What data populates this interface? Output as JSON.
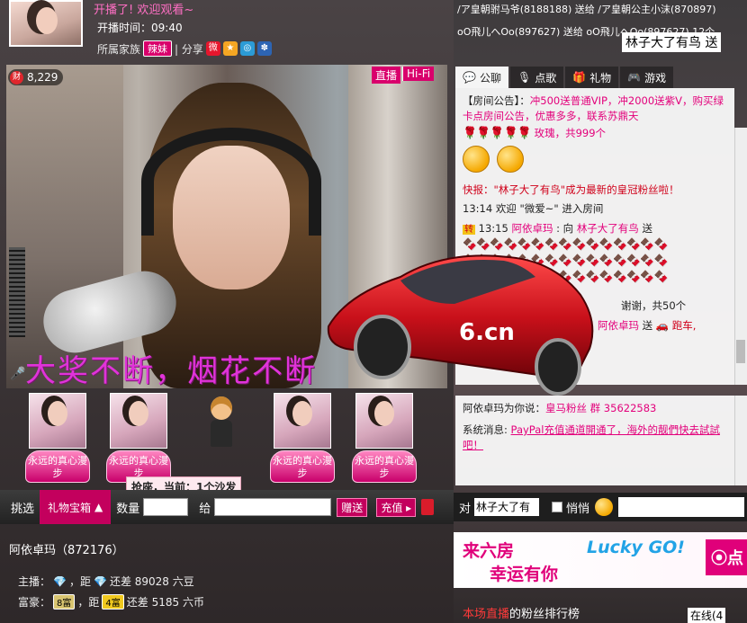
{
  "host": {
    "live_banner": "开播了! 欢迎观看~",
    "start_time": "开播时间：09:40",
    "family_label": "所属家族",
    "family_badge": "辣妹",
    "share_label": "| 分享",
    "name": "阿依卓玛（872176）",
    "host_level_text": "主播：",
    "host_level_mid": "，距",
    "host_level_rest": "还差 89028 六豆",
    "rich_level_text": "富豪：",
    "rich_badge_current": "8富",
    "rich_level_mid": "，距",
    "rich_badge_next": "4富",
    "rich_level_rest": "还差 5185 六币"
  },
  "video": {
    "wealth_value": "8,229",
    "wealth_icon": "财",
    "live_tag": "直播",
    "hifi_tag": "Hi-Fi",
    "overlay_text": "大奖不断，烟花不断"
  },
  "sofa": {
    "seats": [
      {
        "label": "永远的真心漫步"
      },
      {
        "label": "永远的真心漫步"
      },
      {
        "label": "永远的真心漫步"
      },
      {
        "label": "永远的真心漫步"
      }
    ],
    "tip": "抢座，当前：1个沙发"
  },
  "gift_bar": {
    "pick_label": "挑选",
    "gift_box": "礼物宝箱",
    "qty_label": "数量",
    "to_label": "给",
    "give_btn": "赠送",
    "charge_btn": "充值"
  },
  "feed": {
    "line1": "/ア皇朝驸马爷(8188188) 送给 /ア皇朝公主小沫(870897)",
    "line2": "oO飛儿へOo(897627) 送给 oO飛儿へOo(897627) 12个",
    "scroll_name": "林子大了有鸟 送"
  },
  "chat_tabs": [
    {
      "label": "公聊",
      "icon": "chat-bubble-icon"
    },
    {
      "label": "点歌",
      "icon": "microphone-icon"
    },
    {
      "label": "礼物",
      "icon": "gift-icon"
    },
    {
      "label": "游戏",
      "icon": "gamepad-icon"
    }
  ],
  "chat": {
    "announce_label": "【房间公告】：",
    "announce_text": "冲500送普通VIP，冲2000送紫V，购买绿卡点房间公告，优惠多多，联系苏鼎天",
    "roses_text": "玫瑰，共999个",
    "flash_text": "快报：\"林子大了有鸟\"成为最新的皇冠粉丝啦！",
    "welcome_time": "13:14",
    "welcome_text": "欢迎 \"微爱~\" 进入房间",
    "transfer_badge": "转",
    "gift_time": "13:15",
    "gift_from": "阿依卓玛",
    "gift_verb": ": 向",
    "gift_to": "林子大了有鸟",
    "gift_send": "送",
    "thanks_text": "谢谢，共50个",
    "car_from": "阿依卓玛",
    "car_send": "送",
    "car_name": "跑车,",
    "fans_group": "阿依卓玛为你说：",
    "fans_group_link": "皇马粉丝 群 35622583",
    "system_label": "系统消息:",
    "system_text": "PayPal充值通道開通了，海外的靓們快去試試吧！"
  },
  "input_bar": {
    "to_label": "对",
    "target": "林子大了有",
    "quiet_label": "悄悄"
  },
  "ad": {
    "line1": "来六房",
    "line2": "幸运有你",
    "lucky": "Lucky GO!",
    "btn": "点"
  },
  "ranking": {
    "title_red": "本场直播",
    "title_rest": "的粉丝排行榜",
    "online": "在线(4"
  },
  "colors": {
    "accent_pink": "#d9006c",
    "chat_pink": "#e3007b",
    "chat_red": "#d0001a"
  }
}
